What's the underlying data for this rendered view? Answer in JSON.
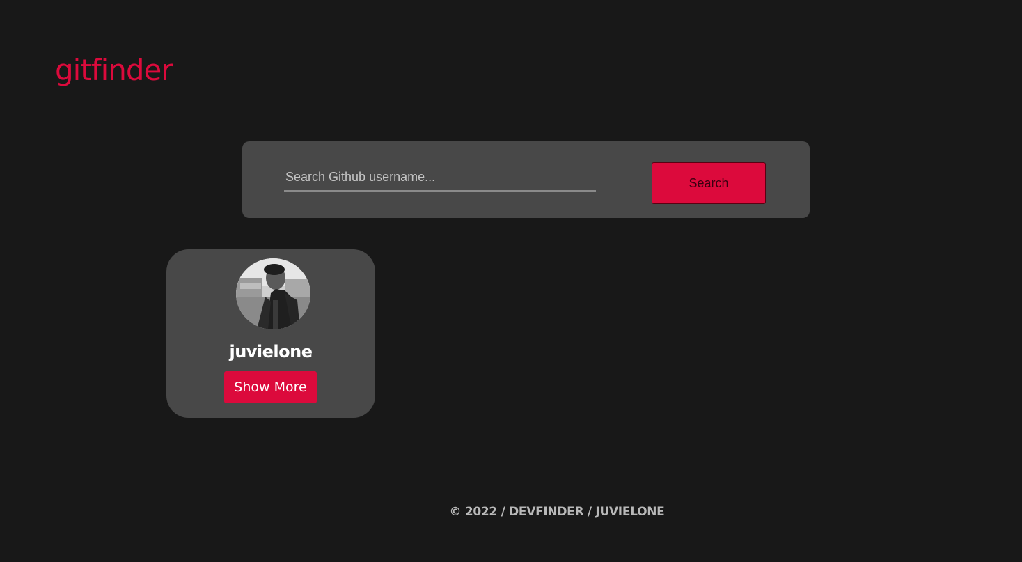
{
  "header": {
    "logo_text": "gitfinder"
  },
  "search": {
    "placeholder": "Search Github username...",
    "value": "",
    "button_label": "Search"
  },
  "results": [
    {
      "username": "juvielone",
      "button_label": "Show More"
    }
  ],
  "footer": {
    "text": "© 2022 / DEVFINDER / JUVIELONE"
  },
  "colors": {
    "background": "#181818",
    "panel": "#484848",
    "accent": "#dc0a3c",
    "text": "#ffffff",
    "muted": "#b8b8b8"
  }
}
